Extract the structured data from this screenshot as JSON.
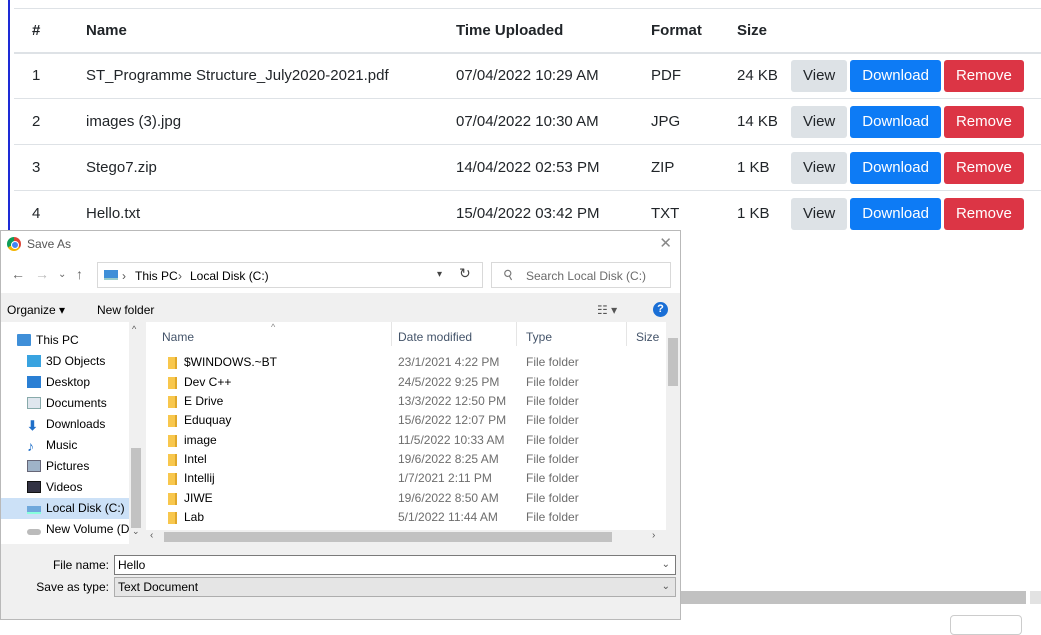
{
  "table": {
    "headers": [
      "#",
      "Name",
      "Time Uploaded",
      "Format",
      "Size"
    ],
    "rows": [
      {
        "num": "1",
        "name": "ST_Programme Structure_July2020-2021.pdf",
        "time": "07/04/2022 10:29 AM",
        "format": "PDF",
        "size": "24 KB"
      },
      {
        "num": "2",
        "name": "images (3).jpg",
        "time": "07/04/2022 10:30 AM",
        "format": "JPG",
        "size": "14 KB"
      },
      {
        "num": "3",
        "name": "Stego7.zip",
        "time": "14/04/2022 02:53 PM",
        "format": "ZIP",
        "size": "1 KB"
      },
      {
        "num": "4",
        "name": "Hello.txt",
        "time": "15/04/2022 03:42 PM",
        "format": "TXT",
        "size": "1 KB"
      }
    ],
    "actions": {
      "view": "View",
      "download": "Download",
      "remove": "Remove"
    }
  },
  "dialog": {
    "title": "Save As",
    "close": "✕",
    "breadcrumb": [
      "This PC",
      "Local Disk (C:)"
    ],
    "search_placeholder": "Search Local Disk (C:)",
    "organize": "Organize ▾",
    "new_folder": "New folder",
    "help": "?",
    "nav_items": [
      "This PC",
      "3D Objects",
      "Desktop",
      "Documents",
      "Downloads",
      "Music",
      "Pictures",
      "Videos",
      "Local Disk (C:)",
      "New Volume (D:"
    ],
    "columns": [
      "Name",
      "Date modified",
      "Type",
      "Size"
    ],
    "files": [
      {
        "name": "$WINDOWS.~BT",
        "date": "23/1/2021 4:22 PM",
        "type": "File folder"
      },
      {
        "name": "Dev C++",
        "date": "24/5/2022 9:25 PM",
        "type": "File folder"
      },
      {
        "name": "E Drive",
        "date": "13/3/2022 12:50 PM",
        "type": "File folder"
      },
      {
        "name": "Eduquay",
        "date": "15/6/2022 12:07 PM",
        "type": "File folder"
      },
      {
        "name": "image",
        "date": "11/5/2022 10:33 AM",
        "type": "File folder"
      },
      {
        "name": "Intel",
        "date": "19/6/2022 8:25 AM",
        "type": "File folder"
      },
      {
        "name": "Intellij",
        "date": "1/7/2021 2:11 PM",
        "type": "File folder"
      },
      {
        "name": "JIWE",
        "date": "19/6/2022 8:50 AM",
        "type": "File folder"
      },
      {
        "name": "Lab",
        "date": "5/1/2022 11:44 AM",
        "type": "File folder"
      }
    ],
    "file_name_label": "File name:",
    "file_name_value": "Hello",
    "save_type_label": "Save as type:",
    "save_type_value": "Text Document"
  }
}
